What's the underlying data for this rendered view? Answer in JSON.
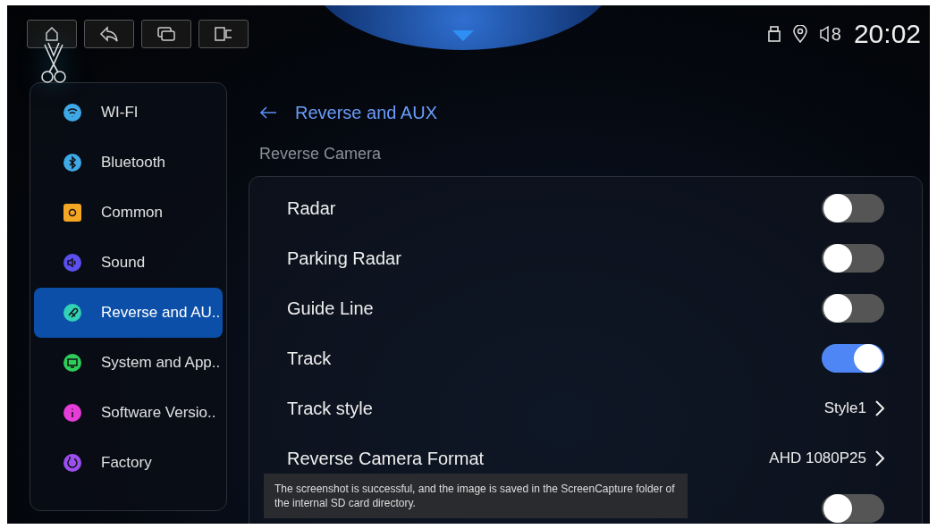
{
  "status_bar": {
    "volume": "8",
    "time": "20:02"
  },
  "sidebar": {
    "items": [
      {
        "label": "WI-FI",
        "color": "#3fa9e8",
        "selected": false
      },
      {
        "label": "Bluetooth",
        "color": "#3fa9e8",
        "selected": false
      },
      {
        "label": "Common",
        "color": "#f5a623",
        "selected": false
      },
      {
        "label": "Sound",
        "color": "#5b4ff0",
        "selected": false
      },
      {
        "label": "Reverse and AU..",
        "color": "#33d1b5",
        "selected": true
      },
      {
        "label": "System and App..",
        "color": "#2ecc5a",
        "selected": false
      },
      {
        "label": "Software Versio..",
        "color": "#e63cd8",
        "selected": false
      },
      {
        "label": "Factory",
        "color": "#9b4ff0",
        "selected": false
      }
    ]
  },
  "page": {
    "title": "Reverse and AUX",
    "section": "Reverse Camera"
  },
  "settings": [
    {
      "kind": "toggle",
      "label": "Radar",
      "on": false
    },
    {
      "kind": "toggle",
      "label": "Parking Radar",
      "on": false
    },
    {
      "kind": "toggle",
      "label": "Guide Line",
      "on": false
    },
    {
      "kind": "toggle",
      "label": "Track",
      "on": true
    },
    {
      "kind": "value",
      "label": "Track style",
      "value": "Style1"
    },
    {
      "kind": "value",
      "label": "Reverse Camera Format",
      "value": "AHD 1080P25"
    },
    {
      "kind": "toggle",
      "on": false
    }
  ],
  "toast": {
    "message": "The screenshot is successful, and the image is saved in the ScreenCapture folder of the internal SD card directory."
  }
}
